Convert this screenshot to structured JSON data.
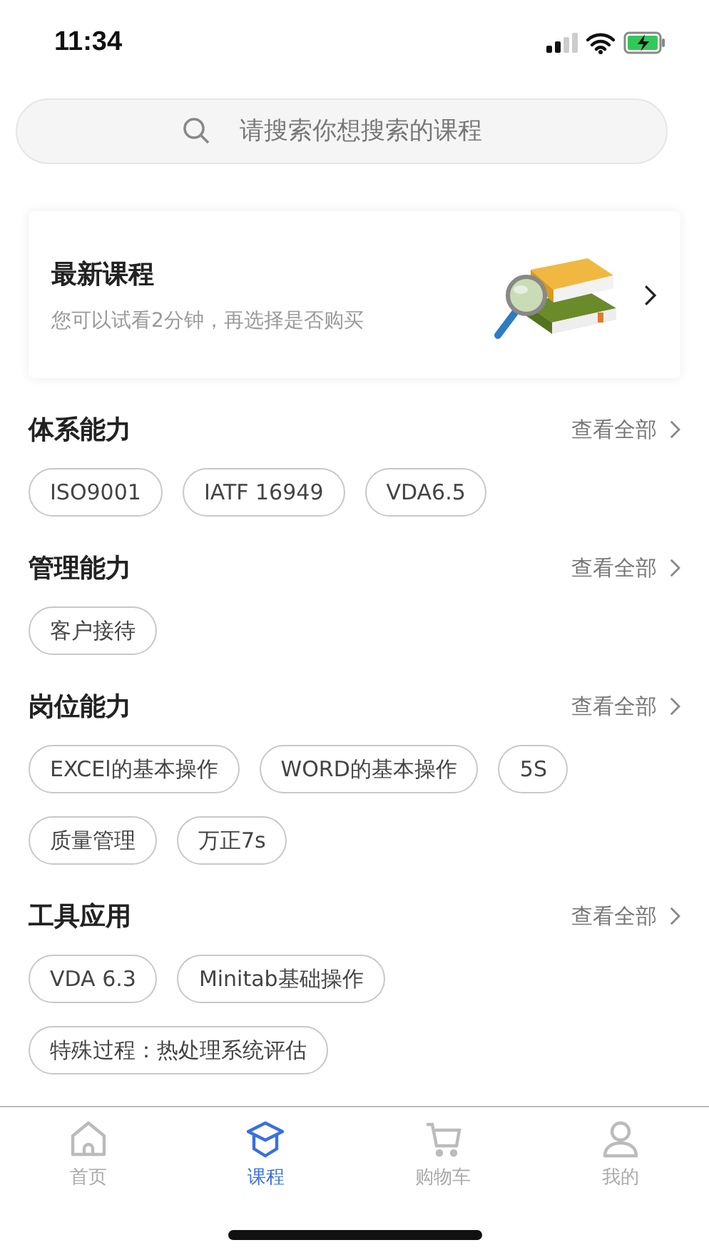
{
  "status_bar": {
    "time": "11:34"
  },
  "search": {
    "placeholder": "请搜索你想搜索的课程"
  },
  "promo": {
    "title": "最新课程",
    "subtitle": "您可以试看2分钟，再选择是否购买"
  },
  "sections": [
    {
      "title": "体系能力",
      "more": "查看全部",
      "chips": [
        "ISO9001",
        "IATF 16949",
        "VDA6.5"
      ]
    },
    {
      "title": "管理能力",
      "more": "查看全部",
      "chips": [
        "客户接待"
      ]
    },
    {
      "title": "岗位能力",
      "more": "查看全部",
      "chips": [
        "EXCEl的基本操作",
        "WORD的基本操作",
        "5S",
        "质量管理",
        "万正7s"
      ]
    },
    {
      "title": "工具应用",
      "more": "查看全部",
      "chips": [
        "VDA 6.3",
        "Minitab基础操作",
        "特殊过程：热处理系统评估"
      ]
    }
  ],
  "tab_bar": [
    {
      "label": "首页",
      "kind": "home",
      "selected": false
    },
    {
      "label": "课程",
      "kind": "course",
      "selected": true
    },
    {
      "label": "购物车",
      "kind": "cart",
      "selected": false
    },
    {
      "label": "我的",
      "kind": "profile",
      "selected": false
    }
  ]
}
